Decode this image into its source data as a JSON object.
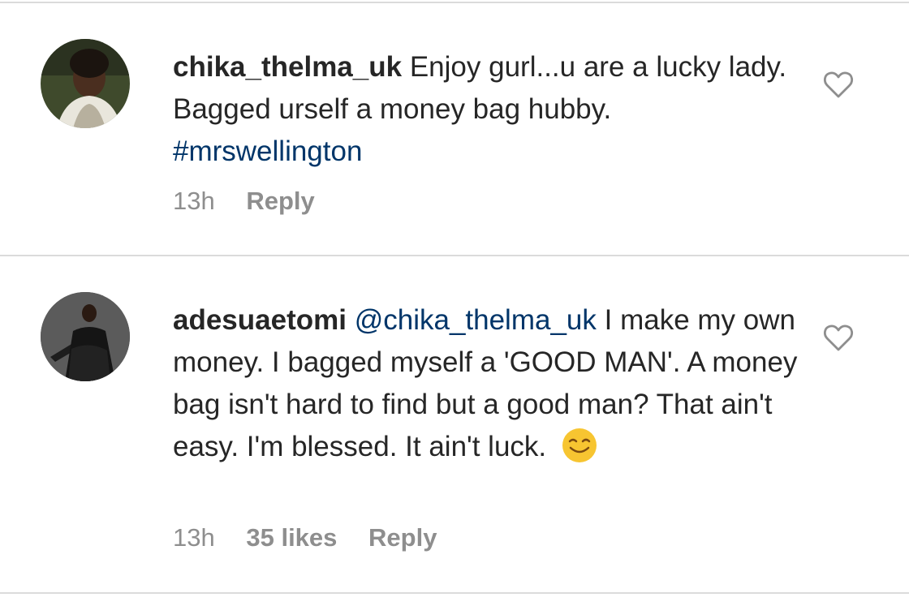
{
  "comments": [
    {
      "username": "chika_thelma_uk",
      "text": "Enjoy gurl...u are a lucky lady. Bagged urself a money bag hubby.",
      "hashtag": "#mrswellington",
      "time": "13h",
      "likes": "",
      "reply_label": "Reply"
    },
    {
      "username": "adesuaetomi",
      "mention": "@chika_thelma_uk",
      "text": "I make my own money. I bagged myself a 'GOOD MAN'. A money bag isn't hard to find but a good man? That ain't easy. I'm blessed. It ain't luck.",
      "emoji": "smiling-face-emoji",
      "time": "13h",
      "likes": "35 likes",
      "reply_label": "Reply"
    }
  ],
  "icons": {
    "like": "heart-outline-icon"
  },
  "colors": {
    "text": "#262626",
    "muted": "#8e8e8e",
    "link": "#003569",
    "divider": "#dbdbdb"
  }
}
